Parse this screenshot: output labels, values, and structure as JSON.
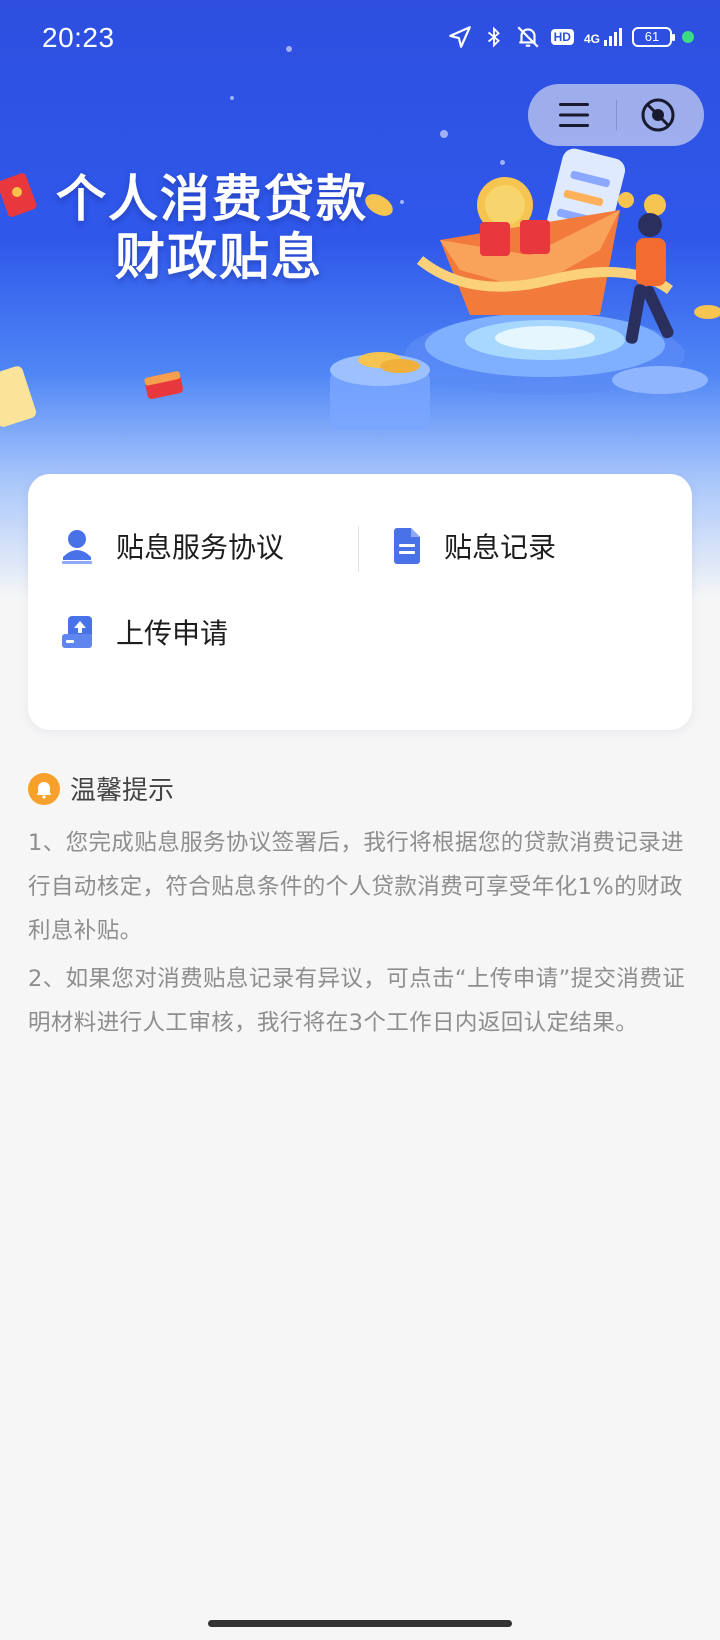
{
  "status_bar": {
    "time": "20:23",
    "network": "4G",
    "hd": "HD",
    "battery": "61",
    "icons": [
      "location-icon",
      "bluetooth-icon",
      "mute-bell-icon",
      "hd-icon",
      "signal-icon",
      "battery-icon"
    ]
  },
  "capsule": {
    "icons": [
      "menu-icon",
      "close-circle-icon"
    ]
  },
  "banner": {
    "title_line1": "个人消费贷款",
    "title_line2": "财政贴息"
  },
  "actions": [
    {
      "label": "贴息服务协议",
      "icon": "user-icon"
    },
    {
      "label": "贴息记录",
      "icon": "document-icon"
    },
    {
      "label": "上传申请",
      "icon": "upload-icon"
    }
  ],
  "tips": {
    "title": "温馨提示",
    "items": [
      "1、您完成贴息服务协议签署后，我行将根据您的贷款消费记录进行自动核定，符合贴息条件的个人贷款消费可享受年化1%的财政利息补贴。",
      "2、如果您对消费贴息记录有异议，可点击“上传申请”提交消费证明材料进行人工审核，我行将在3个工作日内返回认定结果。"
    ]
  },
  "colors": {
    "banner_blue": "#2f58ea",
    "accent_orange": "#f7a02b",
    "icon_blue": "#4a72e8",
    "tip_text": "#8e8e8e"
  }
}
